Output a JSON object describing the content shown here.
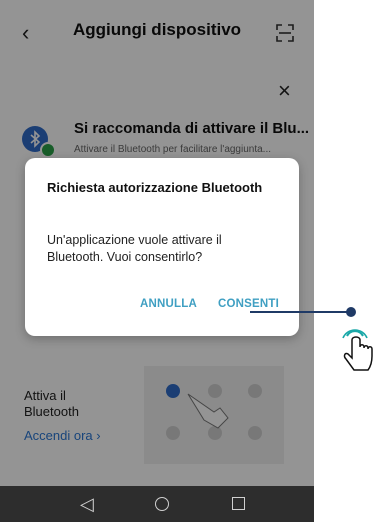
{
  "header": {
    "back_icon": "‹",
    "title": "Aggiungi dispositivo"
  },
  "close_icon": "×",
  "recommendation": {
    "title": "Si raccomanda di attivare il Blu...",
    "subtitle": "Attivare il Bluetooth per facilitare l'aggiunta..."
  },
  "activate": {
    "label": "Attiva il Bluetooth",
    "link": "Accendi ora ›"
  },
  "dialog": {
    "title": "Richiesta autorizzazione Bluetooth",
    "message": "Un'applicazione vuole attivare il Bluetooth. Vuoi consentirlo?",
    "cancel_label": "ANNULLA",
    "confirm_label": "CONSENTI"
  },
  "navbar": {
    "back_icon": "◁"
  },
  "colors": {
    "accent": "#3f9fc2",
    "link": "#2b77d4",
    "pointer": "#1f3a66",
    "hand": "#1aa8a8"
  }
}
